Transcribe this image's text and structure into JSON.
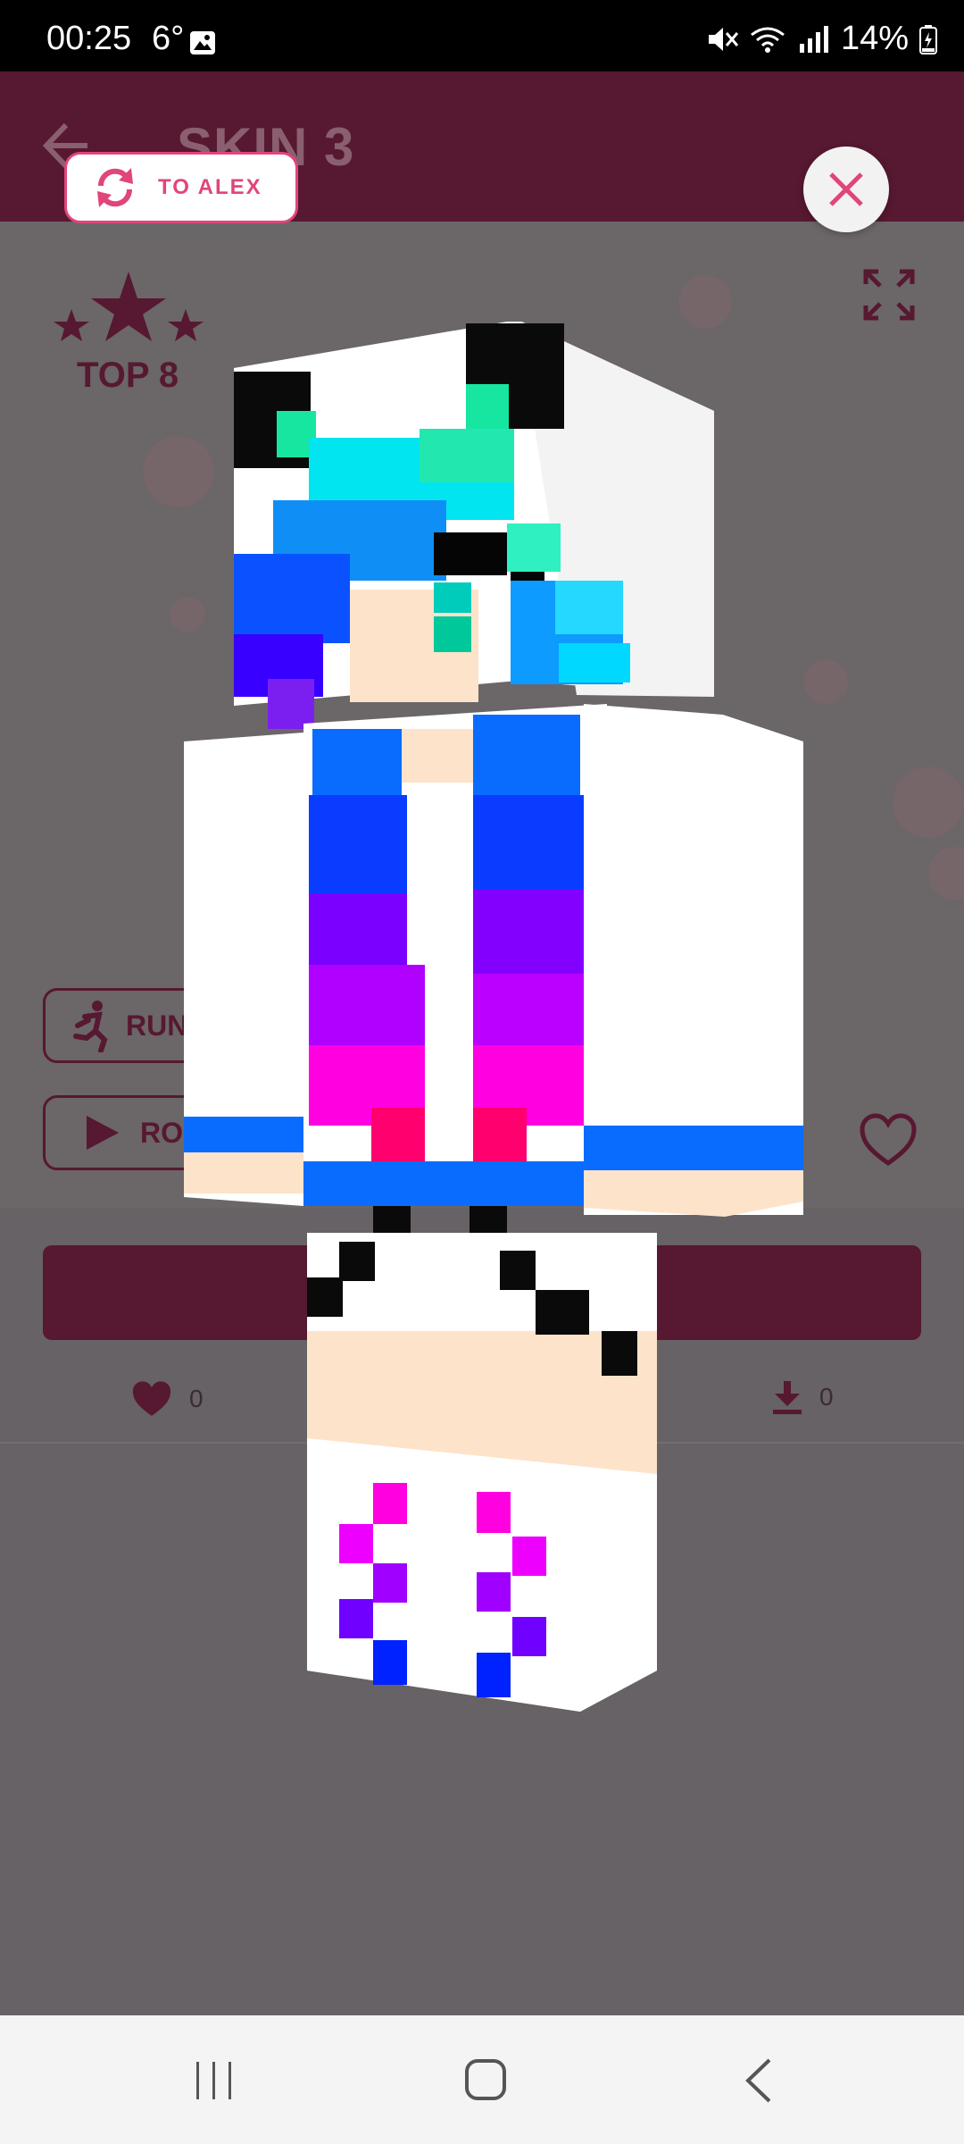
{
  "status_bar": {
    "time": "00:25",
    "temperature": "6°",
    "battery": "14%"
  },
  "app_bar": {
    "title": "SKIN 3"
  },
  "rank": {
    "label": "TOP 8"
  },
  "actions": {
    "run_label": "RUN",
    "rotate_label": "RO"
  },
  "stats": {
    "likes": "0",
    "downloads": "0"
  },
  "overlay": {
    "switch_model_label": "TO ALEX"
  },
  "icons": {
    "back": "arrow-left-icon",
    "close": "close-icon",
    "switch": "refresh-icon",
    "expand": "fullscreen-icon",
    "favorite": "heart-outline-icon",
    "like": "heart-filled-icon",
    "download": "download-icon",
    "run": "running-person-icon",
    "rotate": "play-icon"
  },
  "colors": {
    "primary": "#571831",
    "accent": "#e0457b",
    "overlay_background": "#666266"
  }
}
